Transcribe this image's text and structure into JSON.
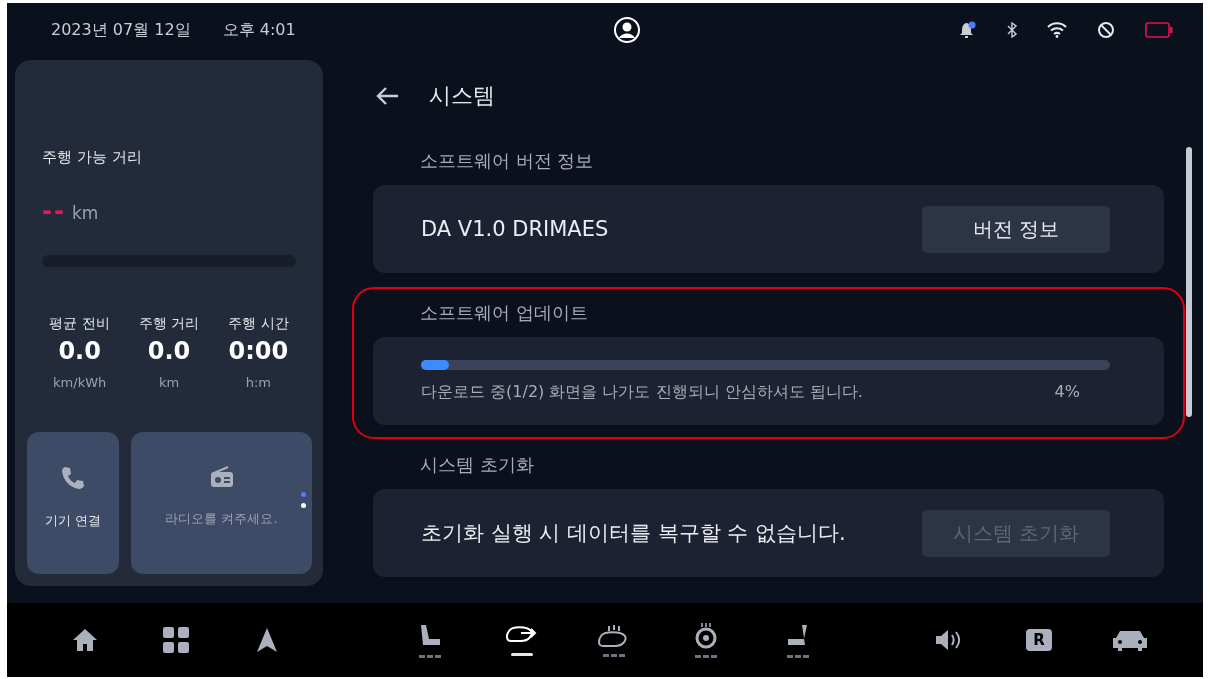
{
  "status_bar": {
    "date": "2023년 07월 12일",
    "time": "오후 4:01"
  },
  "left_panel": {
    "range": {
      "label": "주행 가능 거리",
      "value": "--",
      "unit": "km"
    },
    "stats": [
      {
        "label": "평균 전비",
        "value": "0.0",
        "unit": "km/kWh"
      },
      {
        "label": "주행 거리",
        "value": "0.0",
        "unit": "km"
      },
      {
        "label": "주행 시간",
        "value": "0:00",
        "unit": "h:m"
      }
    ],
    "widgets": [
      {
        "kind": "phone",
        "label": "기기 연결"
      },
      {
        "kind": "radio",
        "label": "라디오를 켜주세요."
      }
    ],
    "pager": [
      {
        "selected": true
      },
      {
        "selected": false
      }
    ]
  },
  "main": {
    "title": "시스템",
    "sections": [
      {
        "kind": "action",
        "label": "소프트웨어 버전 정보",
        "highlighted": false,
        "text": "DA V1.0 DRIMAES",
        "button": {
          "label": "버전 정보",
          "disabled": false
        }
      },
      {
        "kind": "progress",
        "label": "소프트웨어 업데이트",
        "highlighted": true,
        "level": 0.04,
        "message": "다운로드 중(1/2) 화면을 나가도 진행되니 안심하셔도 됩니다.",
        "percent": "4%"
      },
      {
        "kind": "action",
        "label": "시스템 초기화",
        "highlighted": false,
        "text": "초기화 실행 시 데이터를 복구할 수 없습니다.",
        "button": {
          "label": "시스템 초기화",
          "disabled": true
        }
      }
    ]
  },
  "bottom_nav": {
    "left": [
      {
        "kind": "home"
      },
      {
        "kind": "apps"
      },
      {
        "kind": "navigation"
      }
    ],
    "climate": [
      {
        "kind": "seat-heat",
        "selected": false
      },
      {
        "kind": "mirror-heat",
        "selected": true
      },
      {
        "kind": "defrost",
        "selected": false
      },
      {
        "kind": "wheel-heat",
        "selected": false
      },
      {
        "kind": "seat-vent",
        "selected": false
      }
    ],
    "right": [
      {
        "kind": "volume"
      },
      {
        "kind": "camera",
        "label": "R"
      },
      {
        "kind": "car"
      }
    ]
  }
}
